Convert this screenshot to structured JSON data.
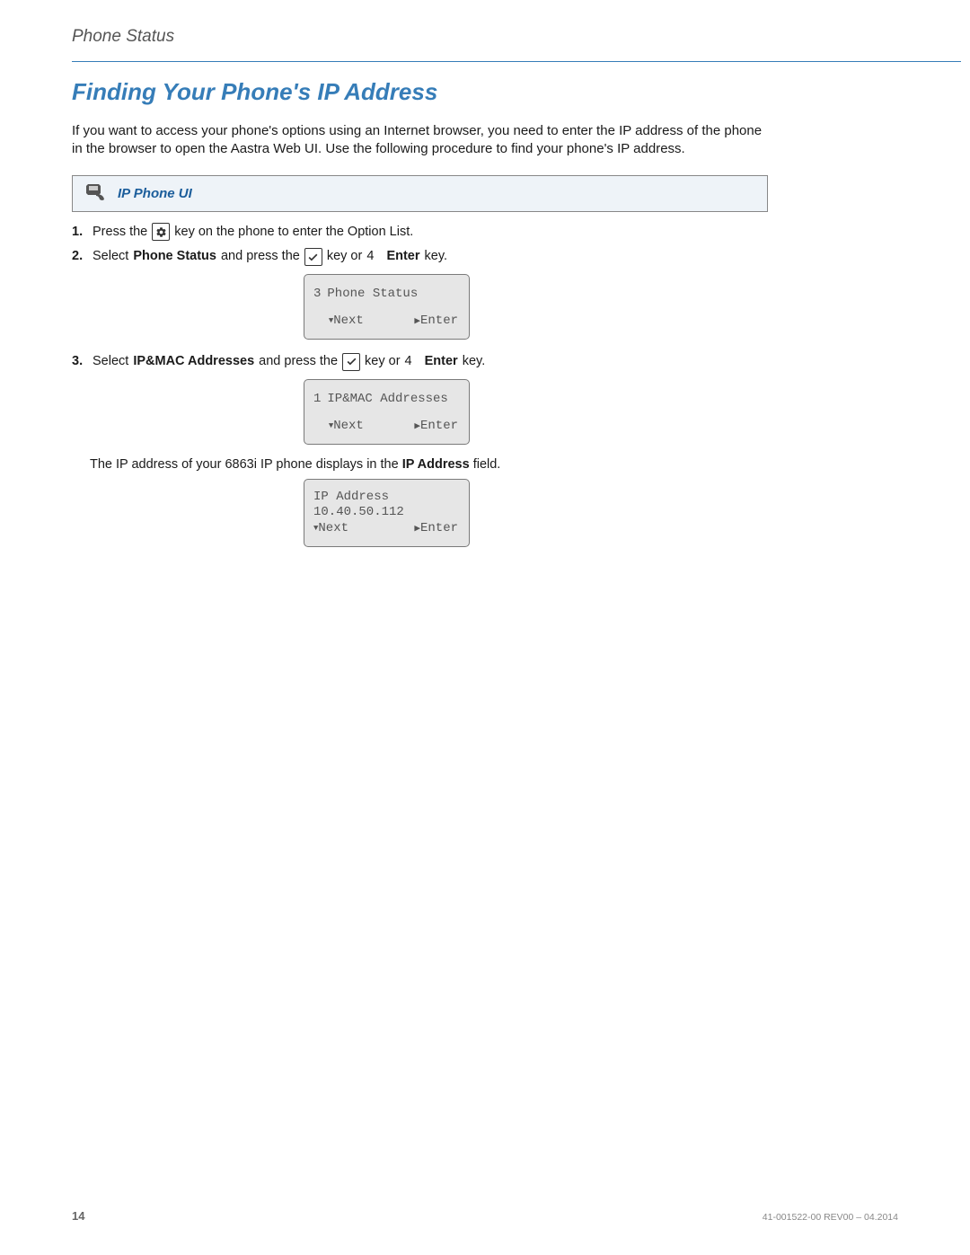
{
  "header": {
    "section": "Phone Status"
  },
  "title": "Finding Your Phone's IP Address",
  "intro": "If you want to access your phone's options using an Internet browser, you need to enter the IP address of the phone in the browser to open the Aastra Web UI. Use the following procedure to find your phone's IP address.",
  "callout": {
    "label": "IP Phone UI"
  },
  "steps": {
    "s1": {
      "num": "1.",
      "a": "Press the",
      "b": "key on the phone to enter the Option List."
    },
    "s2": {
      "num": "2.",
      "a": "Select",
      "bold1": "Phone Status",
      "b": "and press the",
      "c": "key or",
      "four": "4",
      "enter": "Enter",
      "d": "key."
    },
    "s3": {
      "num": "3.",
      "a": "Select",
      "bold1": "IP&MAC Addresses",
      "b": "and press the",
      "c": "key or",
      "four": "4",
      "enter": "Enter",
      "d": "key."
    }
  },
  "lcd1": {
    "num": "3",
    "title": "Phone Status",
    "next": "Next",
    "enter": "Enter"
  },
  "lcd2": {
    "num": "1",
    "title": "IP&MAC Addresses",
    "next": "Next",
    "enter": "Enter"
  },
  "note": {
    "a": "The IP address of your 6863i IP phone displays in the",
    "bold": "IP Address",
    "b": "field."
  },
  "lcd3": {
    "line1": "IP Address",
    "line2": "10.40.50.112",
    "next": "Next",
    "enter": "Enter"
  },
  "footer": {
    "page": "14",
    "rev": "41-001522-00 REV00 – 04.2014"
  }
}
